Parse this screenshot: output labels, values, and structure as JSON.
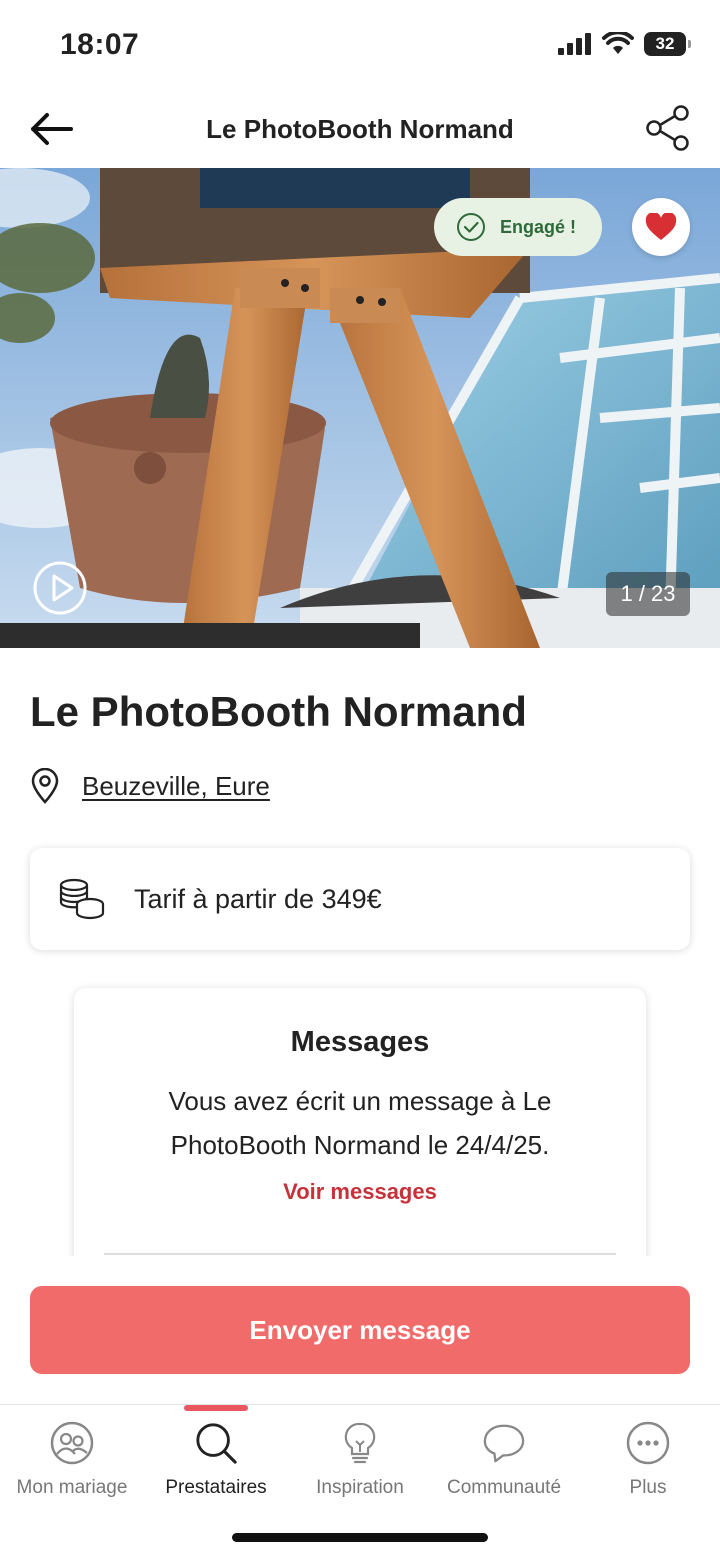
{
  "status_bar": {
    "time": "18:07",
    "battery": "32"
  },
  "header": {
    "title": "Le PhotoBooth Normand"
  },
  "gallery": {
    "badge": "Engagé !",
    "counter": "1 / 23"
  },
  "vendor": {
    "name": "Le PhotoBooth Normand",
    "location": "Beuzeville, Eure"
  },
  "price": {
    "text": "Tarif à partir de 349€"
  },
  "messages": {
    "title": "Messages",
    "body": "Vous avez écrit un message à Le PhotoBooth Normand le 24/4/25.",
    "link": "Voir messages"
  },
  "cta": {
    "label": "Envoyer message"
  },
  "tabs": [
    {
      "label": "Mon mariage",
      "icon": "couple-icon",
      "active": false
    },
    {
      "label": "Prestataires",
      "icon": "search-icon",
      "active": true
    },
    {
      "label": "Inspiration",
      "icon": "lightbulb-icon",
      "active": false
    },
    {
      "label": "Communauté",
      "icon": "chat-bubble-icon",
      "active": false
    },
    {
      "label": "Plus",
      "icon": "more-icon",
      "active": false
    }
  ],
  "colors": {
    "accent": "#f26b6b",
    "link_red": "#c7323a",
    "engaged_green": "#2f6b3a",
    "tab_active_bar": "#e8585e"
  }
}
